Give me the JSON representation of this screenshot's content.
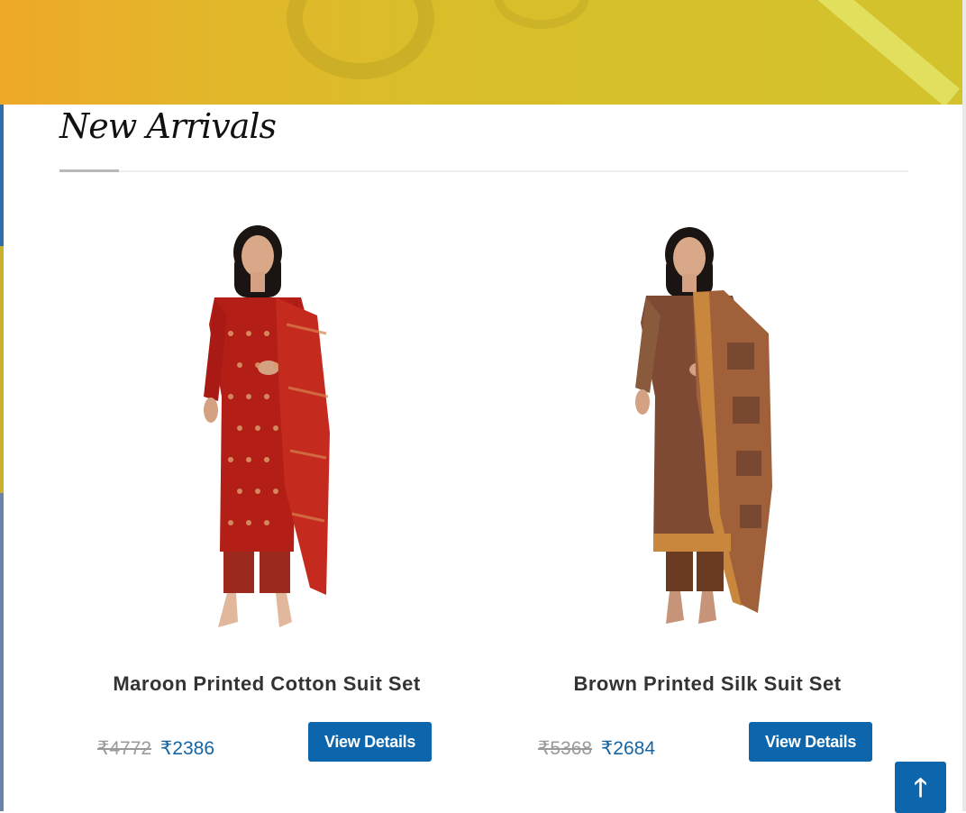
{
  "section": {
    "title": "New Arrivals"
  },
  "products": [
    {
      "title": "Maroon Printed Cotton Suit Set",
      "old_price": "₹4772",
      "new_price": "₹2386",
      "button_label": "View Details"
    },
    {
      "title": "Brown Printed Silk Suit Set",
      "old_price": "₹5368",
      "new_price": "₹2684",
      "button_label": "View Details"
    }
  ],
  "scroll_top": {
    "icon": "arrow-up-icon",
    "glyph": "🡑"
  },
  "colors": {
    "accent_blue": "#0d66ab",
    "price_blue": "#1565a3",
    "banner_yellow": "#d6c12b"
  }
}
